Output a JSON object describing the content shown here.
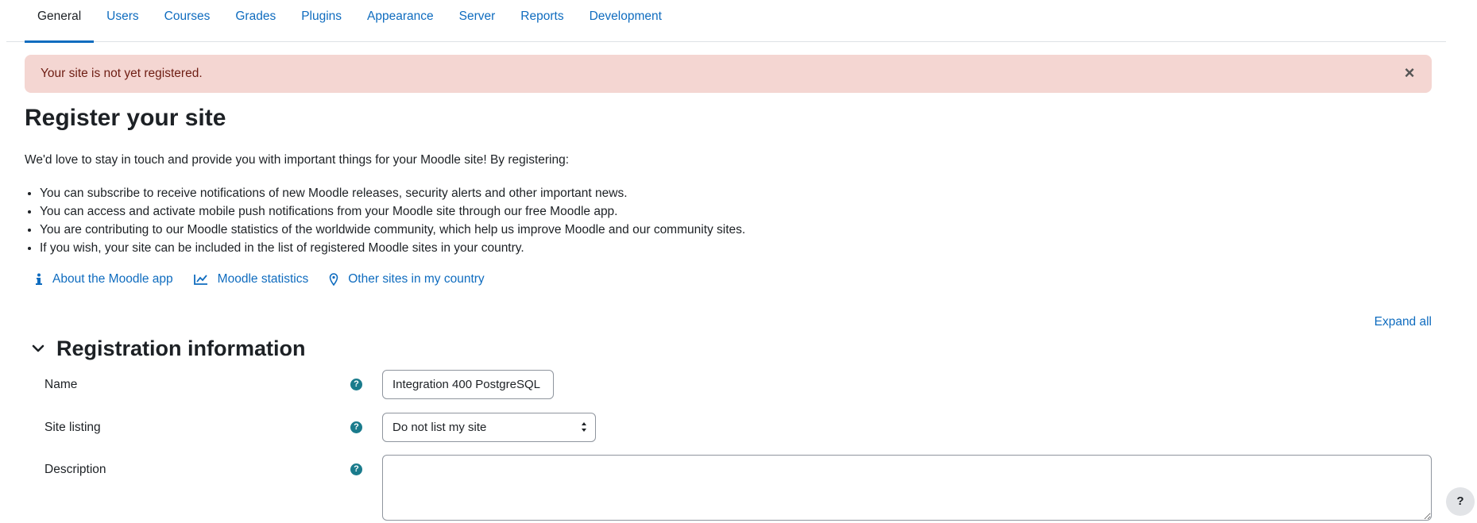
{
  "tabs": [
    {
      "label": "General",
      "active": true
    },
    {
      "label": "Users"
    },
    {
      "label": "Courses"
    },
    {
      "label": "Grades"
    },
    {
      "label": "Plugins"
    },
    {
      "label": "Appearance"
    },
    {
      "label": "Server"
    },
    {
      "label": "Reports"
    },
    {
      "label": "Development"
    }
  ],
  "alert": {
    "message": "Your site is not yet registered.",
    "close_glyph": "×"
  },
  "page": {
    "title": "Register your site",
    "intro": "We'd love to stay in touch and provide you with important things for your Moodle site! By registering:",
    "bullets": [
      "You can subscribe to receive notifications of new Moodle releases, security alerts and other important news.",
      "You can access and activate mobile push notifications from your Moodle site through our free Moodle app.",
      "You are contributing to our Moodle statistics of the worldwide community, which help us improve Moodle and our community sites.",
      "If you wish, your site can be included in the list of registered Moodle sites in your country."
    ]
  },
  "links": [
    {
      "label": "About the Moodle app",
      "icon": "info-icon"
    },
    {
      "label": "Moodle statistics",
      "icon": "line-chart-icon"
    },
    {
      "label": "Other sites in my country",
      "icon": "map-pin-icon"
    }
  ],
  "expand_all": "Expand all",
  "section": {
    "title": "Registration information"
  },
  "form": {
    "name_label": "Name",
    "name_value": "Integration 400 PostgreSQL",
    "site_listing_label": "Site listing",
    "site_listing_value": "Do not list my site",
    "description_label": "Description",
    "help_glyph": "?"
  },
  "help_fab": "?",
  "colors": {
    "link": "#0f6cbf",
    "alert_bg": "#f4d6d2",
    "help_icon": "#1a7b8c"
  }
}
